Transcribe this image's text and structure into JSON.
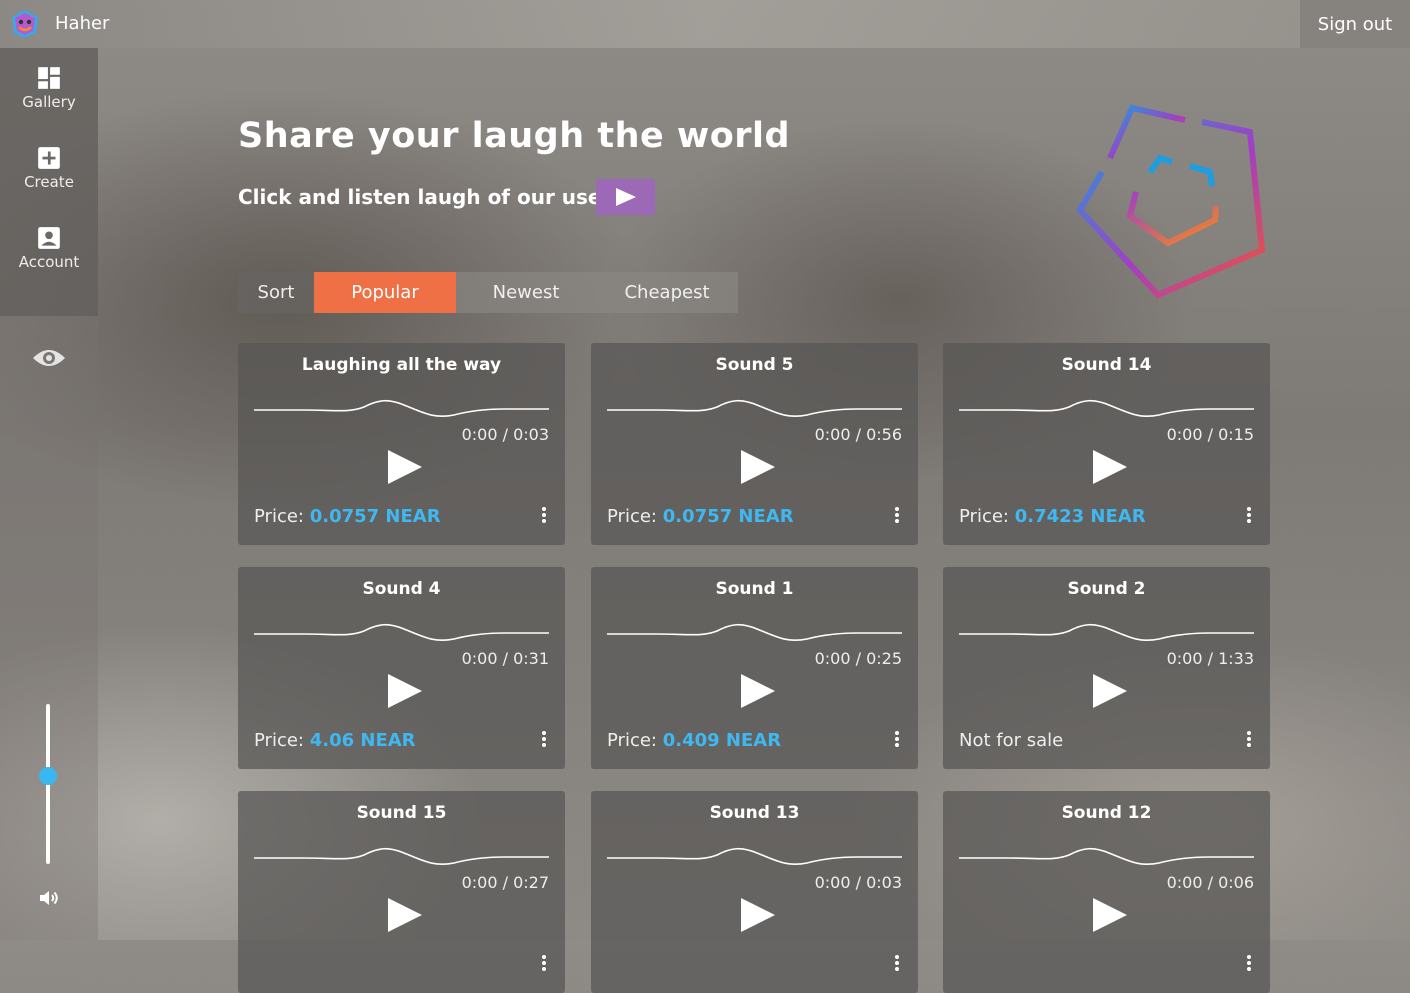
{
  "app": {
    "name": "Haher",
    "signout": "Sign out"
  },
  "nav": [
    {
      "label": "Gallery",
      "icon": "gallery-icon"
    },
    {
      "label": "Create",
      "icon": "plus-icon"
    },
    {
      "label": "Account",
      "icon": "account-icon"
    }
  ],
  "volume": {
    "level": 0.6
  },
  "hero": {
    "title": "Share your laugh the world",
    "subtitle": "Click and listen laugh of our users"
  },
  "sort": {
    "label": "Sort",
    "options": [
      "Popular",
      "Newest",
      "Cheapest"
    ],
    "selected": "Popular"
  },
  "colors": {
    "accent": "#ef7045",
    "price": "#3fb8f2",
    "hero_play": "#9c69b6",
    "slider": "#39b7f0"
  },
  "cards": [
    {
      "title": "Laughing all the way",
      "time": "0:00 / 0:03",
      "price_label": "Price: ",
      "price": "0.0757 NEAR"
    },
    {
      "title": "Sound 5",
      "time": "0:00 / 0:56",
      "price_label": "Price: ",
      "price": "0.0757 NEAR"
    },
    {
      "title": "Sound 14",
      "time": "0:00 / 0:15",
      "price_label": "Price: ",
      "price": "0.7423 NEAR"
    },
    {
      "title": "Sound 4",
      "time": "0:00 / 0:31",
      "price_label": "Price: ",
      "price": "4.06 NEAR"
    },
    {
      "title": "Sound 1",
      "time": "0:00 / 0:25",
      "price_label": "Price: ",
      "price": "0.409 NEAR"
    },
    {
      "title": "Sound 2",
      "time": "0:00 / 1:33",
      "price_label": "Not for sale",
      "price": ""
    },
    {
      "title": "Sound 15",
      "time": "0:00 / 0:27",
      "price_label": "",
      "price": ""
    },
    {
      "title": "Sound 13",
      "time": "0:00 / 0:03",
      "price_label": "",
      "price": ""
    },
    {
      "title": "Sound 12",
      "time": "0:00 / 0:06",
      "price_label": "",
      "price": ""
    }
  ]
}
